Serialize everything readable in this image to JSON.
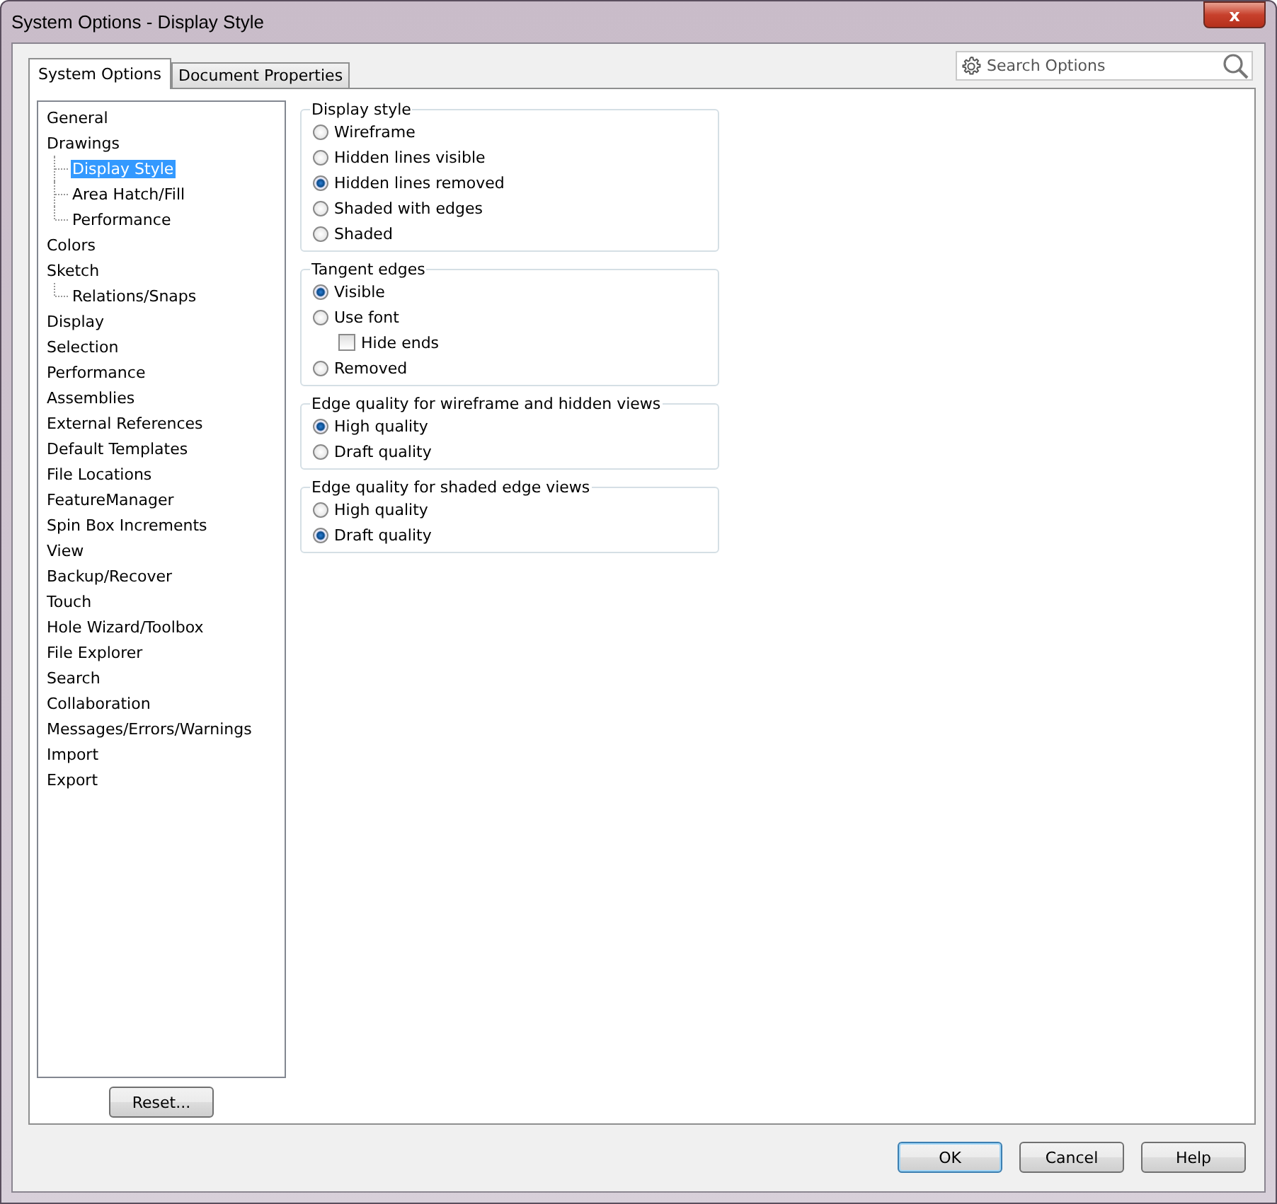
{
  "window": {
    "title": "System Options - Display Style",
    "close_label": "x"
  },
  "tabs": [
    {
      "label": "System Options",
      "selected": true
    },
    {
      "label": "Document Properties",
      "selected": false
    }
  ],
  "search": {
    "placeholder": "Search Options"
  },
  "tree": [
    {
      "label": "General",
      "selected": false
    },
    {
      "label": "Drawings",
      "selected": false,
      "children": [
        {
          "label": "Display Style",
          "selected": true
        },
        {
          "label": "Area Hatch/Fill",
          "selected": false
        },
        {
          "label": "Performance",
          "selected": false
        }
      ]
    },
    {
      "label": "Colors",
      "selected": false
    },
    {
      "label": "Sketch",
      "selected": false,
      "children": [
        {
          "label": "Relations/Snaps",
          "selected": false
        }
      ]
    },
    {
      "label": "Display",
      "selected": false
    },
    {
      "label": "Selection",
      "selected": false
    },
    {
      "label": "Performance",
      "selected": false
    },
    {
      "label": "Assemblies",
      "selected": false
    },
    {
      "label": "External References",
      "selected": false
    },
    {
      "label": "Default Templates",
      "selected": false
    },
    {
      "label": "File Locations",
      "selected": false
    },
    {
      "label": "FeatureManager",
      "selected": false
    },
    {
      "label": "Spin Box Increments",
      "selected": false
    },
    {
      "label": "View",
      "selected": false
    },
    {
      "label": "Backup/Recover",
      "selected": false
    },
    {
      "label": "Touch",
      "selected": false
    },
    {
      "label": "Hole Wizard/Toolbox",
      "selected": false
    },
    {
      "label": "File Explorer",
      "selected": false
    },
    {
      "label": "Search",
      "selected": false
    },
    {
      "label": "Collaboration",
      "selected": false
    },
    {
      "label": "Messages/Errors/Warnings",
      "selected": false
    },
    {
      "label": "Import",
      "selected": false
    },
    {
      "label": "Export",
      "selected": false
    }
  ],
  "reset_button": "Reset...",
  "groups": [
    {
      "title": "Display style",
      "options": [
        {
          "kind": "radio",
          "label": "Wireframe",
          "selected": false
        },
        {
          "kind": "radio",
          "label": "Hidden lines visible",
          "selected": false
        },
        {
          "kind": "radio",
          "label": "Hidden lines removed",
          "selected": true
        },
        {
          "kind": "radio",
          "label": "Shaded with edges",
          "selected": false
        },
        {
          "kind": "radio",
          "label": "Shaded",
          "selected": false
        }
      ]
    },
    {
      "title": "Tangent edges",
      "options": [
        {
          "kind": "radio",
          "label": "Visible",
          "selected": true
        },
        {
          "kind": "radio",
          "label": "Use font",
          "selected": false,
          "children": [
            {
              "kind": "checkbox",
              "label": "Hide ends",
              "checked": false
            }
          ]
        },
        {
          "kind": "radio",
          "label": "Removed",
          "selected": false
        }
      ]
    },
    {
      "title": "Edge quality for wireframe and hidden views",
      "options": [
        {
          "kind": "radio",
          "label": "High quality",
          "selected": true
        },
        {
          "kind": "radio",
          "label": "Draft quality",
          "selected": false
        }
      ]
    },
    {
      "title": "Edge quality for shaded edge views",
      "options": [
        {
          "kind": "radio",
          "label": "High quality",
          "selected": false
        },
        {
          "kind": "radio",
          "label": "Draft quality",
          "selected": true
        }
      ]
    }
  ],
  "buttons": [
    {
      "label": "OK",
      "default": true
    },
    {
      "label": "Cancel",
      "default": false
    },
    {
      "label": "Help",
      "default": false
    }
  ]
}
